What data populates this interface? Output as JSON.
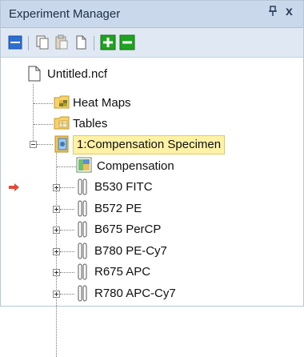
{
  "window": {
    "title": "Experiment Manager",
    "pin_glyph": "ᵖ",
    "close_glyph": "x"
  },
  "toolbar": {
    "icons": [
      "panel-icon",
      "copy-icon",
      "paste-icon",
      "document-icon",
      "add-icon",
      "remove-icon"
    ]
  },
  "tree": {
    "root": "Untitled.ncf",
    "heat_maps": "Heat Maps",
    "tables": "Tables",
    "specimen": "1:Compensation Specimen",
    "compensation": "Compensation",
    "tubes": [
      "B530 FITC",
      "B572 PE",
      "B675 PerCP",
      "B780 PE-Cy7",
      "R675 APC",
      "R780 APC-Cy7"
    ]
  },
  "colors": {
    "title_bar": "#c9d8ea",
    "toolbar": "#dfe8f3",
    "selection": "#fff1a6",
    "add": "#21a321",
    "remove": "#21a321",
    "pointer_arrow": "#e04b3a"
  }
}
